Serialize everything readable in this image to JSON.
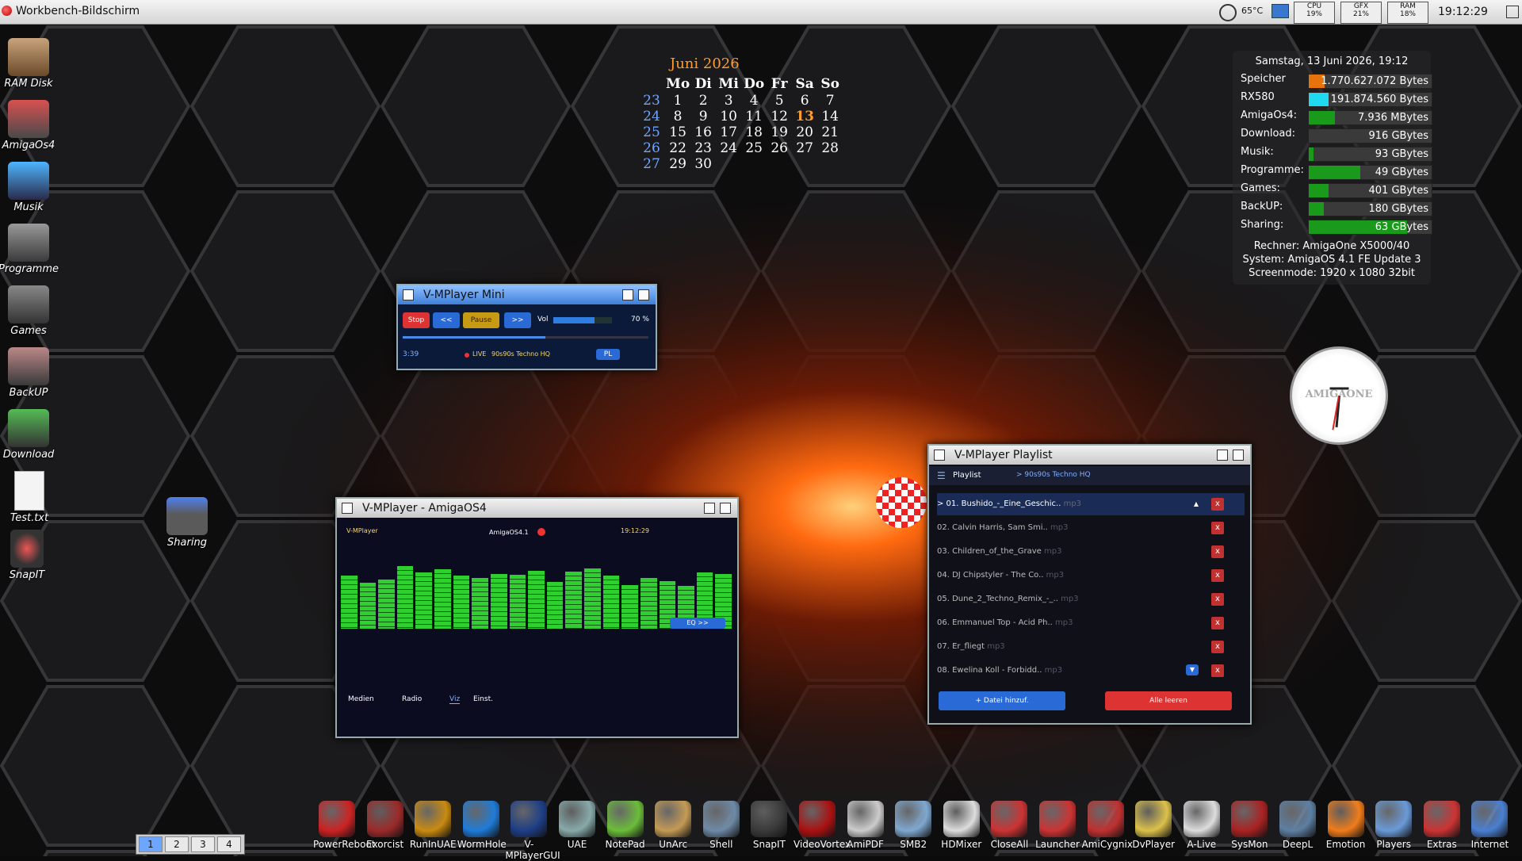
{
  "screen": {
    "title": "Workbench-Bildschirm"
  },
  "topbar": {
    "temp": "65°C",
    "meters": [
      {
        "label": "CPU",
        "value": "19%",
        "level": 0.19
      },
      {
        "label": "GFX",
        "value": "21%",
        "level": 0.21
      },
      {
        "label": "RAM",
        "value": "18%",
        "level": 0.18
      }
    ],
    "time": "19:12:29"
  },
  "desktop_icons": [
    {
      "label": "RAM Disk"
    },
    {
      "label": "AmigaOs4"
    },
    {
      "label": "Musik"
    },
    {
      "label": "Programme"
    },
    {
      "label": "Games"
    },
    {
      "label": "BackUP"
    },
    {
      "label": "Download"
    },
    {
      "label": "Test.txt"
    },
    {
      "label": "SnapIT"
    },
    {
      "label": "Sharing"
    }
  ],
  "calendar": {
    "month": "Juni 2026",
    "days": [
      "Mo",
      "Di",
      "Mi",
      "Do",
      "Fr",
      "Sa",
      "So"
    ],
    "weeks": [
      {
        "wk": "23",
        "d": [
          "1",
          "2",
          "3",
          "4",
          "5",
          "6",
          "7"
        ]
      },
      {
        "wk": "24",
        "d": [
          "8",
          "9",
          "10",
          "11",
          "12",
          "13",
          "14"
        ]
      },
      {
        "wk": "25",
        "d": [
          "15",
          "16",
          "17",
          "18",
          "19",
          "20",
          "21"
        ]
      },
      {
        "wk": "26",
        "d": [
          "22",
          "23",
          "24",
          "25",
          "26",
          "27",
          "28"
        ]
      },
      {
        "wk": "27",
        "d": [
          "29",
          "30",
          "",
          "",
          "",
          "",
          ""
        ]
      }
    ],
    "today": "13"
  },
  "sysinfo": {
    "date": "Samstag, 13 Juni 2026, 19:12",
    "rows": [
      {
        "label": "Speicher",
        "value": "1.770.627.072 Bytes",
        "level": 0.13,
        "color": "#e8730c"
      },
      {
        "label": "RX580",
        "value": "191.874.560 Bytes",
        "level": 0.16,
        "color": "#20d8f0"
      },
      {
        "label": "AmigaOs4:",
        "value": "7.936 MBytes",
        "level": 0.21,
        "color": "#1a9a1a"
      },
      {
        "label": "Download:",
        "value": "916 GBytes",
        "level": 0.0,
        "color": "#1a9a1a"
      },
      {
        "label": "Musik:",
        "value": "93 GBytes",
        "level": 0.04,
        "color": "#1a9a1a"
      },
      {
        "label": "Programme:",
        "value": "49 GBytes",
        "level": 0.42,
        "color": "#1a9a1a"
      },
      {
        "label": "Games:",
        "value": "401 GBytes",
        "level": 0.16,
        "color": "#1a9a1a"
      },
      {
        "label": "BackUP:",
        "value": "180 GBytes",
        "level": 0.12,
        "color": "#1a9a1a"
      },
      {
        "label": "Sharing:",
        "value": "63 GBytes",
        "level": 0.8,
        "color": "#1a9a1a"
      }
    ],
    "rechner": "Rechner: AmigaOne X5000/40",
    "system": "System: AmigaOS 4.1 FE Update 3",
    "screenmode": "Screenmode: 1920 x 1080 32bit"
  },
  "clock": {
    "brand": "AMIGAONE"
  },
  "mini": {
    "title": "V-MPlayer Mini",
    "stop": "Stop",
    "prev": "<<",
    "pause": "Pause",
    "next": ">>",
    "vol_label": "Vol",
    "vol_value": "70 %",
    "volume": 0.7,
    "progress": 0.58,
    "time": "3:39",
    "live": "LIVE",
    "station": "90s90s Techno HQ",
    "pl": "PL"
  },
  "main": {
    "title": "V-MPlayer - AmigaOS4",
    "app": "V-MPlayer",
    "os": "AmigaOS4.1",
    "clock": "19:12:29",
    "eq": "EQ >>",
    "tabs": [
      "Medien",
      "Radio",
      "Viz",
      "Einst."
    ],
    "levels": [
      0.64,
      0.56,
      0.6,
      0.76,
      0.68,
      0.72,
      0.64,
      0.62,
      0.66,
      0.65,
      0.7,
      0.57,
      0.69,
      0.73,
      0.64,
      0.53,
      0.62,
      0.58,
      0.52,
      0.68,
      0.66
    ]
  },
  "playlist": {
    "title": "V-MPlayer Playlist",
    "tab": "Playlist",
    "station": "> 90s90s Techno HQ",
    "items": [
      {
        "n": "> 01. Bushido_-_Eine_Geschic..",
        "ext": "mp3"
      },
      {
        "n": "02. Calvin Harris, Sam Smi..",
        "ext": "mp3"
      },
      {
        "n": "03. Children_of_the_Grave",
        "ext": "mp3"
      },
      {
        "n": "04. DJ Chipstyler - The Co..",
        "ext": "mp3"
      },
      {
        "n": "05. Dune_2_Techno_Remix_-_..",
        "ext": "mp3"
      },
      {
        "n": "06. Emmanuel Top - Acid Ph..",
        "ext": "mp3"
      },
      {
        "n": "07. Er_fliegt",
        "ext": "mp3"
      },
      {
        "n": "08. Ewelina Koll - Forbidd..",
        "ext": "mp3"
      }
    ],
    "remove": "x",
    "add": "+ Datei hinzuf.",
    "clear": "Alle leeren"
  },
  "dock": [
    {
      "label": "PowerReboot",
      "icon": "power-icon",
      "color": "#c22"
    },
    {
      "label": "Exorcist",
      "icon": "exorcist-icon",
      "color": "#9b2a2a"
    },
    {
      "label": "RunInUAE",
      "icon": "uae-icon",
      "color": "#c98a10"
    },
    {
      "label": "WormHole",
      "icon": "wormhole-icon",
      "color": "#1f7bd8"
    },
    {
      "label": "V-MPlayerGUI",
      "icon": "vmplayer-icon",
      "color": "#1d3e86"
    },
    {
      "label": "UAE",
      "icon": "uae-window-icon",
      "color": "#8aa"
    },
    {
      "label": "NotePad",
      "icon": "notepad-icon",
      "color": "#6bbd3a"
    },
    {
      "label": "UnArc",
      "icon": "archive-icon",
      "color": "#c49a55"
    },
    {
      "label": "Shell",
      "icon": "shell-icon",
      "color": "#6e8aa6"
    },
    {
      "label": "SnapIT",
      "icon": "snapit-icon",
      "color": "#3a3a3a"
    },
    {
      "label": "VideoVortex",
      "icon": "videovortex-icon",
      "color": "#a11"
    },
    {
      "label": "AmiPDF",
      "icon": "pdf-icon",
      "color": "#ccc"
    },
    {
      "label": "SMB2",
      "icon": "smb-icon",
      "color": "#7fa8d0"
    },
    {
      "label": "HDMixer",
      "icon": "mixer-icon",
      "color": "#ddd"
    },
    {
      "label": "CloseAll",
      "icon": "closeall-icon",
      "color": "#c33"
    },
    {
      "label": "Launcher",
      "icon": "launcher-icon",
      "color": "#c33"
    },
    {
      "label": "AmiCygnix",
      "icon": "cygnix-icon",
      "color": "#c03030"
    },
    {
      "label": "DvPlayer",
      "icon": "dvplayer-icon",
      "color": "#dcc14a"
    },
    {
      "label": "A-Live",
      "icon": "alive-icon",
      "color": "#ddd"
    },
    {
      "label": "SysMon",
      "icon": "sysmon-icon",
      "color": "#a22"
    },
    {
      "label": "DeepL",
      "icon": "deepl-icon",
      "color": "#5d7fa2"
    },
    {
      "label": "Emotion",
      "icon": "emotion-icon",
      "color": "#f07c1a"
    },
    {
      "label": "Players",
      "icon": "players-icon",
      "color": "#6a9ad8"
    },
    {
      "label": "Extras",
      "icon": "extras-icon",
      "color": "#c33"
    },
    {
      "label": "Internet",
      "icon": "globe-icon",
      "color": "#4a7fd0"
    }
  ],
  "workspaces": [
    "1",
    "2",
    "3",
    "4"
  ]
}
